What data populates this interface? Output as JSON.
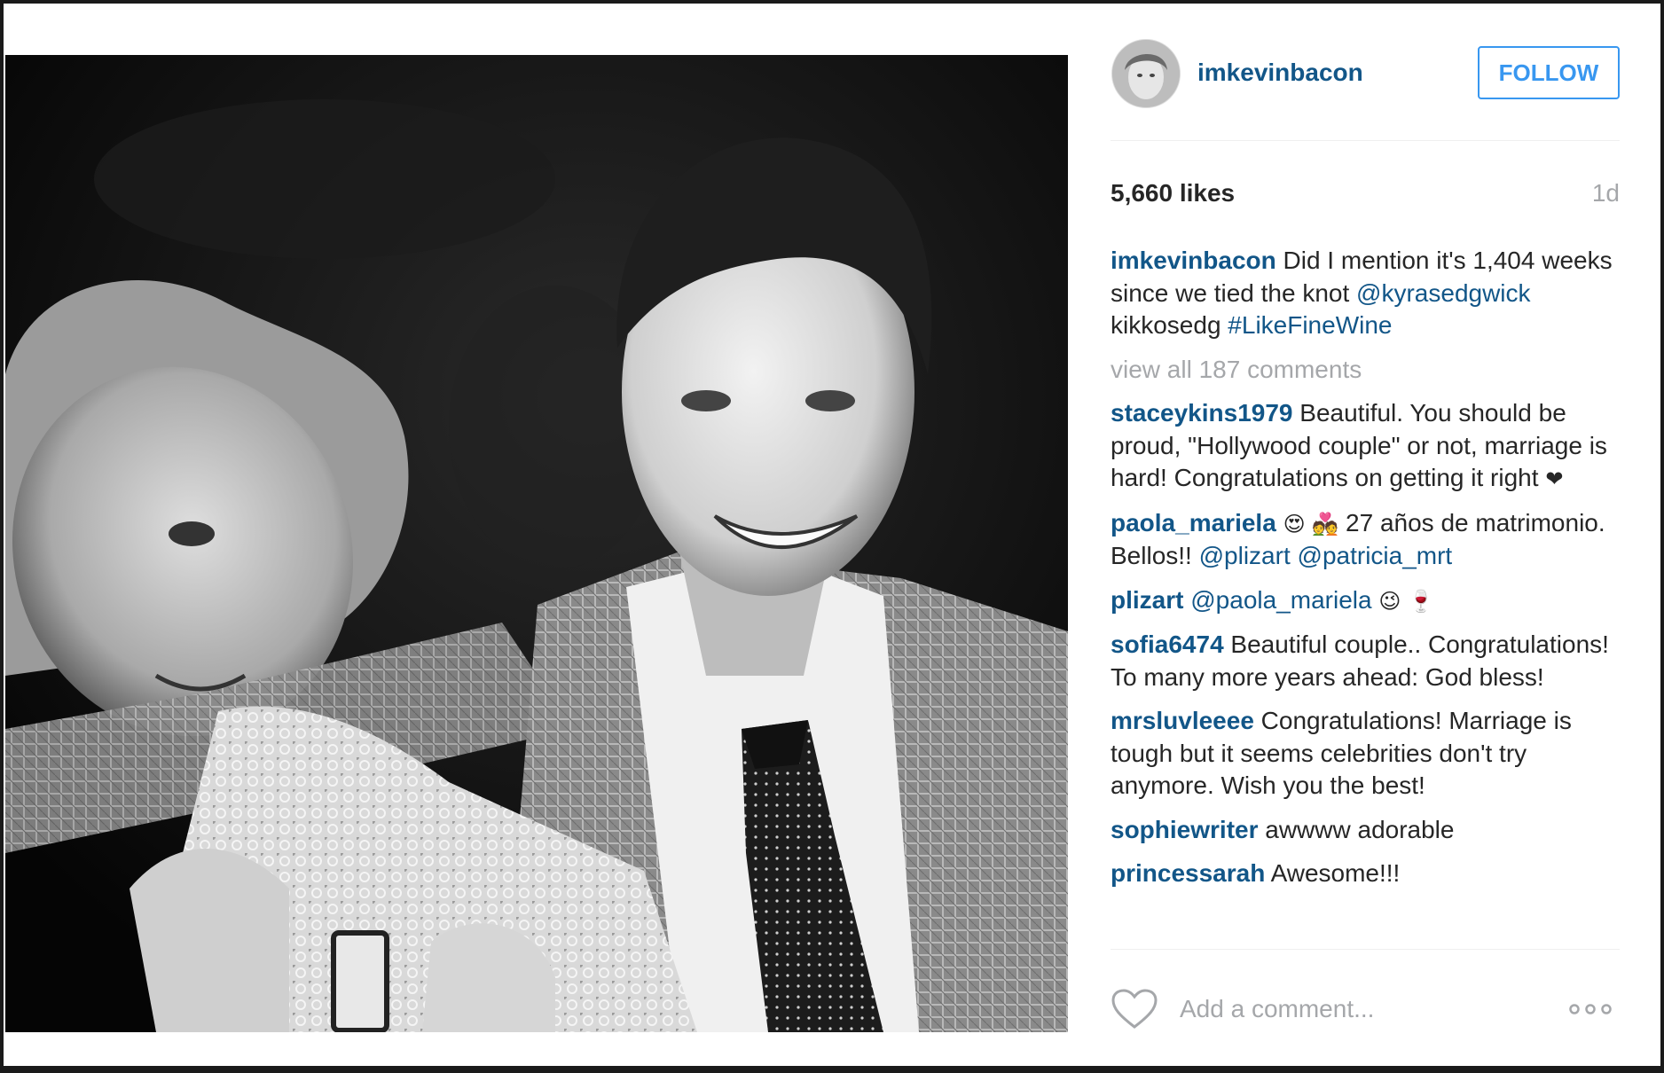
{
  "post": {
    "username": "imkevinbacon",
    "follow_label": "FOLLOW",
    "likes": "5,660 likes",
    "age": "1d",
    "caption": {
      "user": "imkevinbacon",
      "text_1": " Did I mention it's 1,404 weeks since we tied the knot ",
      "mention": "@kyrasedgwick",
      "text_2": " kikkosedg ",
      "hashtag": "#LikeFineWine"
    },
    "view_all": "view all 187 comments",
    "comments": [
      {
        "user": "staceykins1979",
        "text": " Beautiful. You should be proud, \"Hollywood couple\" or not, marriage is hard! Congratulations on getting it right ",
        "emoji": "❤"
      },
      {
        "user": "paola_mariela",
        "emoji_1": "😍",
        "emoji_2": "💑",
        "text": "  27 años de matrimonio. Bellos!! ",
        "mention_1": "@plizart",
        "mention_2": "@patricia_mrt"
      },
      {
        "user": "plizart",
        "mention": "@paola_mariela",
        "emoji_1": "😉",
        "emoji_2": "🍷"
      },
      {
        "user": "sofia6474",
        "text": " Beautiful couple.. Congratulations! To many more years ahead: God bless!"
      },
      {
        "user": "mrsluvleeee",
        "text": " Congratulations! Marriage is tough but it seems celebrities don't try anymore. Wish you the best!"
      },
      {
        "user": "sophiewriter",
        "text": " awwww adorable"
      },
      {
        "user": "princessarah",
        "text": " Awesome!!!"
      }
    ],
    "add_comment_placeholder": "Add a comment..."
  },
  "icons": {
    "heart": "heart-outline-icon",
    "more": "more-options-icon"
  },
  "colors": {
    "username": "#125688",
    "follow": "#3897f0",
    "muted": "#a5a7aa",
    "text": "#262626"
  }
}
